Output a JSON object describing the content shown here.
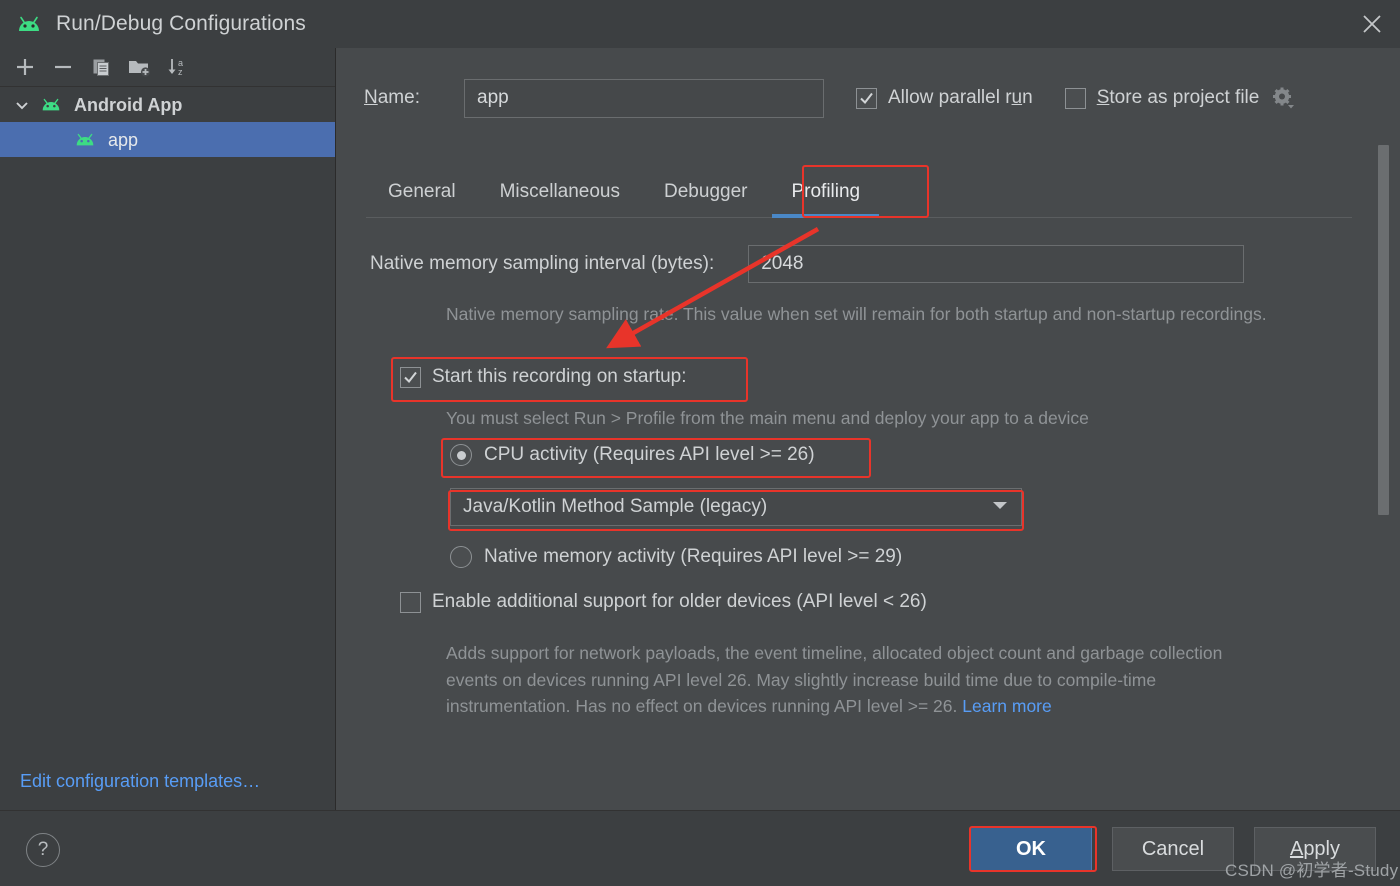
{
  "window": {
    "title": "Run/Debug Configurations",
    "app_icon": "android-icon",
    "close_icon": "close-icon"
  },
  "sidebar": {
    "toolbar": [
      {
        "name": "add-button",
        "icon": "plus-icon"
      },
      {
        "name": "remove-button",
        "icon": "minus-icon"
      },
      {
        "name": "copy-button",
        "icon": "copy-icon"
      },
      {
        "name": "save-configuration-button",
        "icon": "folder-add-icon"
      },
      {
        "name": "sort-button",
        "icon": "sort-az-icon"
      }
    ],
    "tree": {
      "group_label": "Android App",
      "child_label": "app"
    },
    "edit_templates_link": "Edit configuration templates…"
  },
  "form": {
    "name_label_prefix": "N",
    "name_label_rest": "ame:",
    "name_value": "app",
    "name_placeholder": "",
    "allow_parallel_run": {
      "label_a": "Allow parallel r",
      "label_u": "u",
      "label_b": "n",
      "checked": true
    },
    "store_as_project_file": {
      "label_s": "S",
      "label_rest": "tore as project file",
      "checked": false
    },
    "gear_icon": "gear-dropdown-icon"
  },
  "tabs": [
    {
      "label": "General",
      "active": false
    },
    {
      "label": "Miscellaneous",
      "active": false
    },
    {
      "label": "Debugger",
      "active": false
    },
    {
      "label": "Profiling",
      "active": true
    }
  ],
  "profiling": {
    "sampling_interval_label": "Native memory sampling interval (bytes):",
    "sampling_interval_value": "2048",
    "sampling_hint": "Native memory sampling rate. This value when set will remain for both startup and non-startup recordings.",
    "start_on_startup_label": "Start this recording on startup:",
    "start_on_startup_checked": true,
    "startup_hint": "You must select Run > Profile from the main menu and deploy your app to a device",
    "radio_cpu_label": "CPU activity (Requires API level >= 26)",
    "radio_cpu_selected": true,
    "combo_value": "Java/Kotlin Method Sample (legacy)",
    "combo_arrow_icon": "chevron-down-icon",
    "radio_native_label": "Native memory activity (Requires API level >= 29)",
    "radio_native_selected": false,
    "older_devices_label": "Enable additional support for older devices (API level < 26)",
    "older_devices_checked": false,
    "older_devices_desc": "Adds support for network payloads, the event timeline, allocated object count and garbage collection events on devices running API level 26. May slightly increase build time due to compile-time instrumentation. Has no effect on devices running API level >= 26. ",
    "learn_more_label": "Learn more"
  },
  "footer": {
    "help_label": "?",
    "ok_label": "OK",
    "cancel_label": "Cancel",
    "apply_label_a": "A",
    "apply_label_rest": "pply"
  },
  "watermark": "CSDN @初学者-Study",
  "colors": {
    "accent_blue": "#4a88c7",
    "selection_blue": "#4b6eaf",
    "link_blue": "#589df6",
    "annotation_red": "#e8342a",
    "android_green": "#3ddc84",
    "panel_bg": "#474a4c",
    "sidebar_bg": "#3c3f41"
  }
}
